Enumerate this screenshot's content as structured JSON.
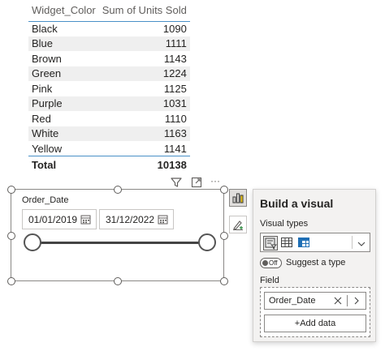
{
  "table": {
    "headers": [
      "Widget_Color",
      "Sum of Units Sold"
    ],
    "rows": [
      {
        "color": "Black",
        "units": "1090"
      },
      {
        "color": "Blue",
        "units": "1111"
      },
      {
        "color": "Brown",
        "units": "1143"
      },
      {
        "color": "Green",
        "units": "1224"
      },
      {
        "color": "Pink",
        "units": "1125"
      },
      {
        "color": "Purple",
        "units": "1031"
      },
      {
        "color": "Red",
        "units": "1110"
      },
      {
        "color": "White",
        "units": "1163"
      },
      {
        "color": "Yellow",
        "units": "1141"
      }
    ],
    "total_label": "Total",
    "total_value": "10138"
  },
  "visual_header": {
    "icons": [
      "filter-icon",
      "focus-mode-icon",
      "more-options-icon"
    ],
    "more_label": "···"
  },
  "slicer": {
    "title": "Order_Date",
    "start_date": "01/01/2019",
    "end_date": "31/12/2022"
  },
  "build_panel": {
    "title": "Build a visual",
    "visual_types_label": "Visual types",
    "visual_type_icons": [
      "slicer-icon",
      "table-icon",
      "matrix-icon"
    ],
    "toggle_state": "Off",
    "suggest_label": "Suggest a type",
    "field_label": "Field",
    "field_value": "Order_Date",
    "add_data_label": "+Add data"
  },
  "colors": {
    "accent": "#4a90c8",
    "panel_bg": "#f3f2f1",
    "text": "#252423",
    "row_alt": "#efefef"
  }
}
